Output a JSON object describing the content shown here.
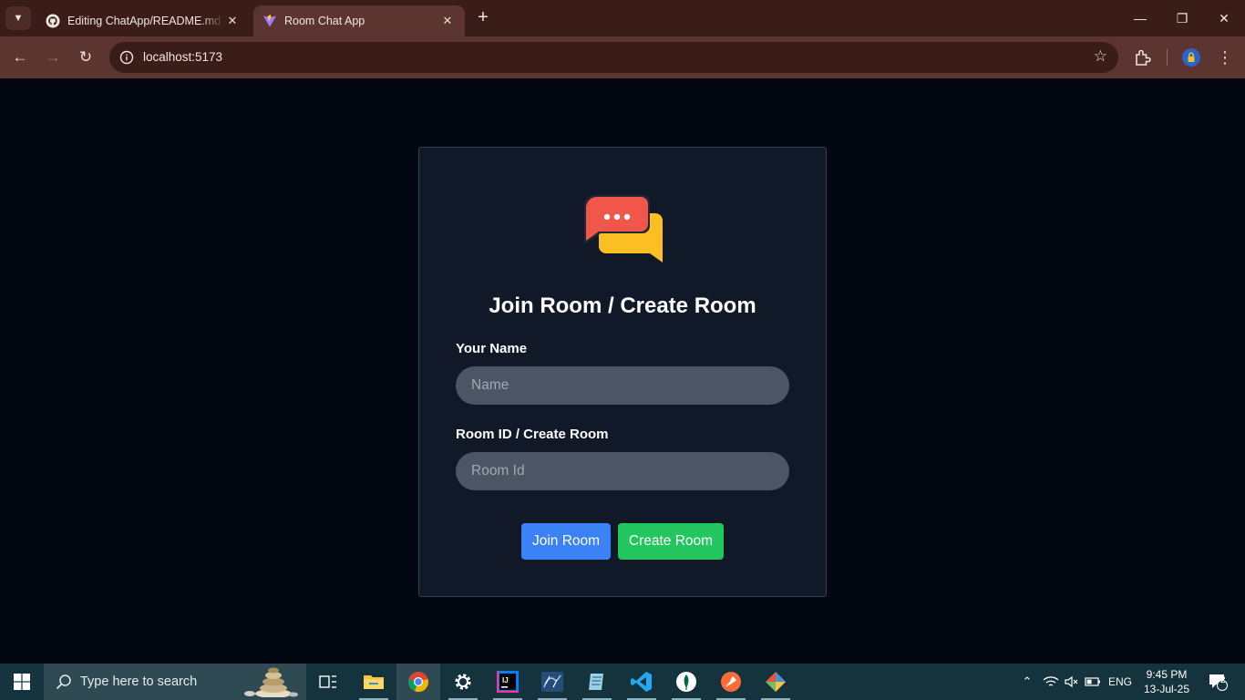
{
  "browser": {
    "tabs": [
      {
        "title": "Editing ChatApp/README.md at",
        "icon": "github-icon"
      },
      {
        "title": "Room Chat App",
        "icon": "vite-icon"
      }
    ],
    "url": "localhost:5173"
  },
  "app": {
    "heading": "Join Room / Create Room",
    "name_label": "Your Name",
    "name_placeholder": "Name",
    "room_label": "Room ID / Create Room",
    "room_placeholder": "Room Id",
    "join_button": "Join Room",
    "create_button": "Create Room",
    "colors": {
      "join": "#3b82f6",
      "create": "#22c55e",
      "card": "#111827"
    }
  },
  "taskbar": {
    "search_placeholder": "Type here to search",
    "language": "ENG",
    "time": "9:45 PM",
    "date": "13-Jul-25",
    "notification_count": "2"
  }
}
